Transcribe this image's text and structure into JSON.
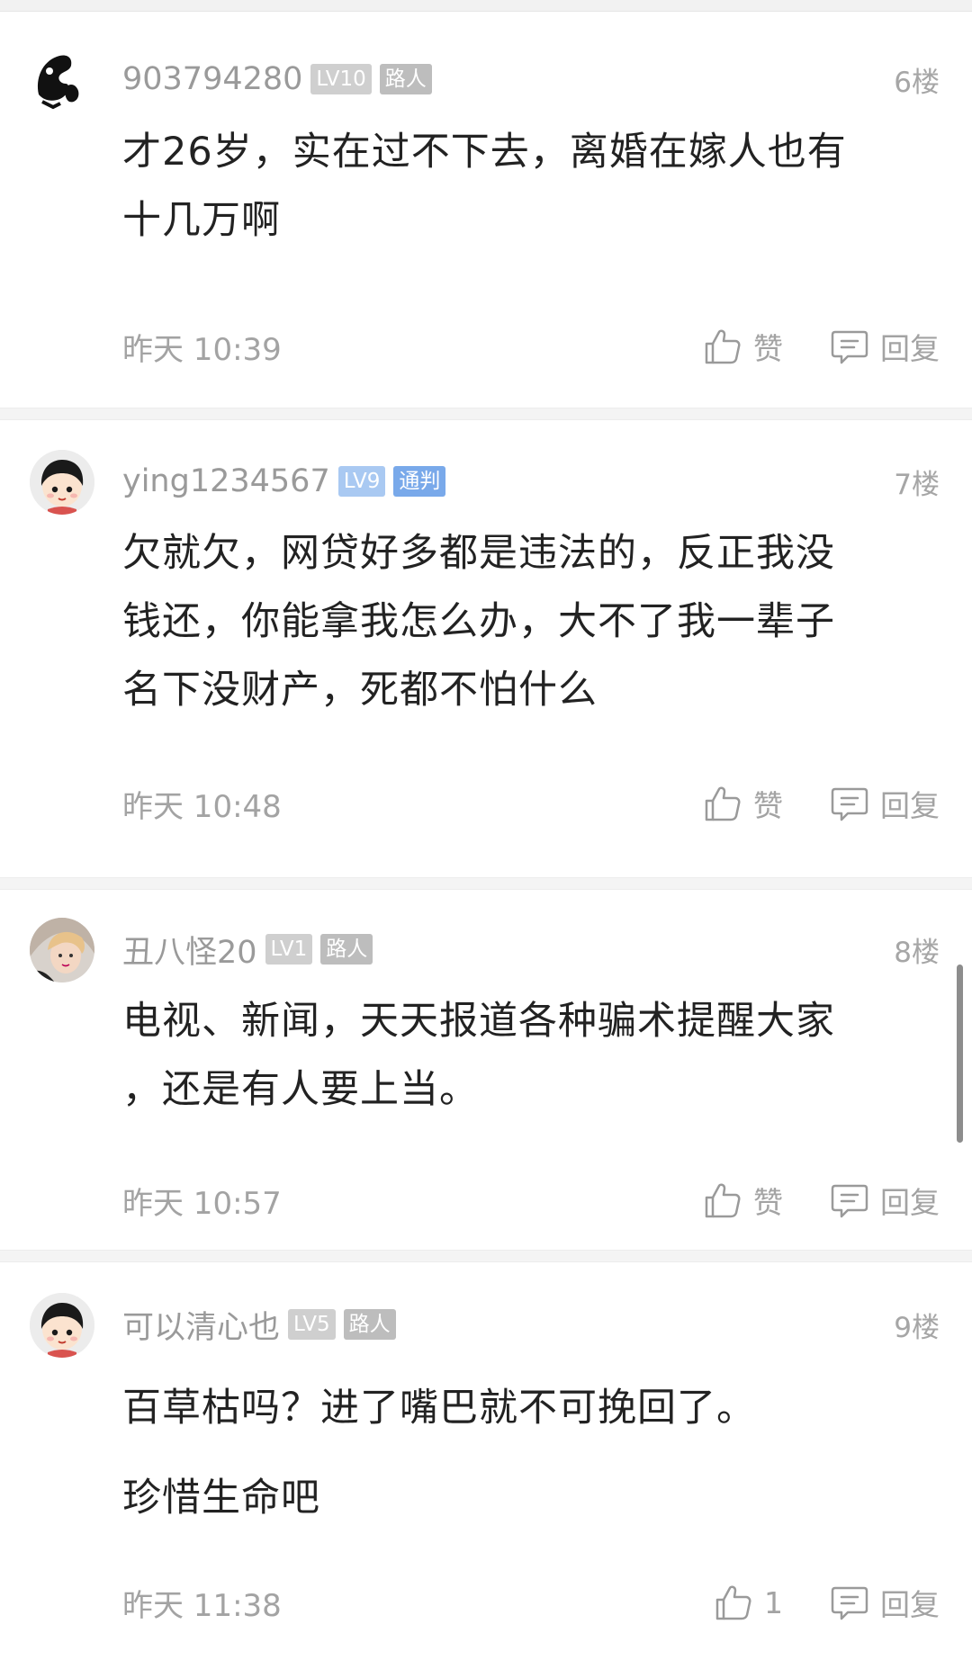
{
  "comments": [
    {
      "username": "903794280",
      "level": "LV10",
      "role": "路人",
      "floor": "6楼",
      "lines": [
        "才26岁，实在过不下去，离婚在嫁人也有",
        "十几万啊"
      ],
      "time": "昨天 10:39",
      "like_label": "赞",
      "reply_label": "回复"
    },
    {
      "username": "ying1234567",
      "level": "LV9",
      "role": "通判",
      "floor": "7楼",
      "lines": [
        "欠就欠，网贷好多都是违法的，反正我没",
        "钱还，你能拿我怎么办，大不了我一辈子",
        "名下没财产，死都不怕什么"
      ],
      "time": "昨天 10:48",
      "like_label": "赞",
      "reply_label": "回复"
    },
    {
      "username": "丑八怪20",
      "level": "LV1",
      "role": "路人",
      "floor": "8楼",
      "lines": [
        "电视、新闻，天天报道各种骗术提醒大家",
        "，还是有人要上当。"
      ],
      "time": "昨天 10:57",
      "like_label": "赞",
      "reply_label": "回复"
    },
    {
      "username": "可以清心也",
      "level": "LV5",
      "role": "路人",
      "floor": "9楼",
      "lines": [
        "百草枯吗？进了嘴巴就不可挽回了。",
        "珍惜生命吧"
      ],
      "time": "昨天 11:38",
      "like_label": "1",
      "reply_label": "回复"
    }
  ],
  "icons": {
    "like": "thumbs-up-icon",
    "reply": "comment-bubble-icon"
  },
  "colors": {
    "meta_text": "#a3a3a3",
    "body_text": "#222222",
    "badge_gray": "#bdbdbd",
    "badge_blue": "#79a9ea"
  }
}
